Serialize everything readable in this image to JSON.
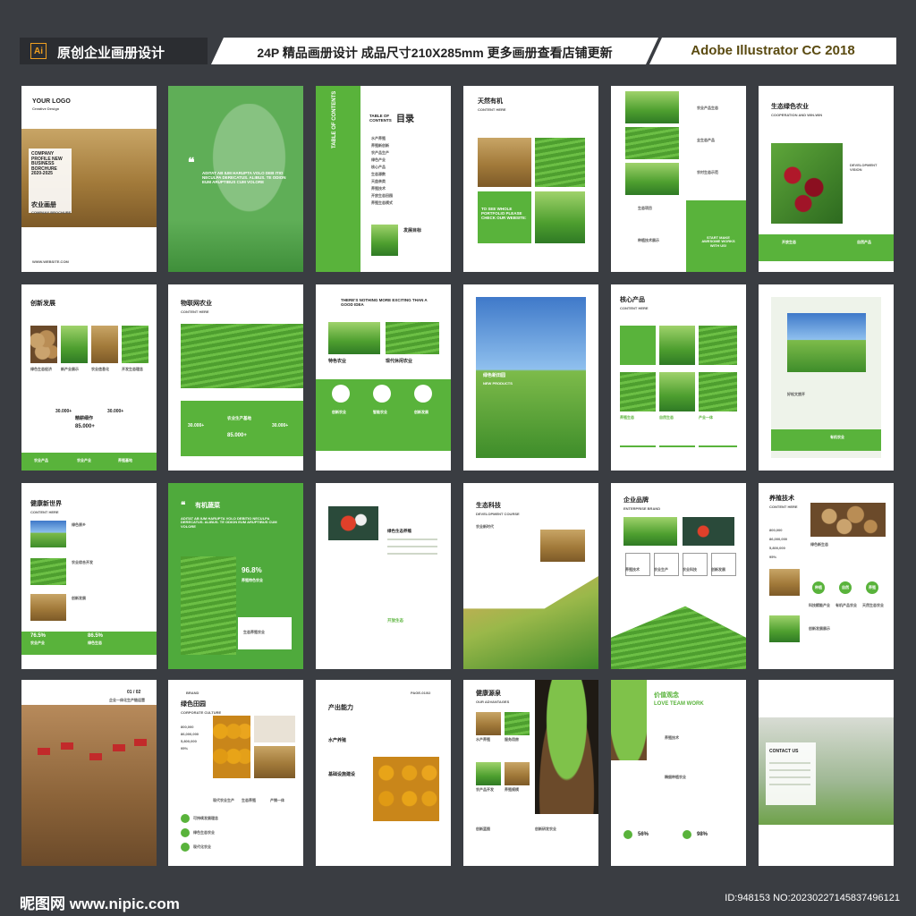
{
  "header": {
    "badge": "Ai",
    "left_title": "原创企业画册设计",
    "middle_title": "24P 精品画册设计 成品尺寸210X285mm 更多画册查看店铺更新",
    "right_title": "Adobe Illustrator CC 2018"
  },
  "pages": {
    "p1": {
      "logo": "YOUR LOGO",
      "logo_sub": "Creative Design",
      "title": "COMPANY PROFILE NEW BUSINESS BORCHURE 2020-2025",
      "cn": "农业画册",
      "cn_sub": "COMPANY BROCHURE",
      "footer": "WWW.WEBSITE.COM"
    },
    "p2": {
      "quote": "ADITAT AB IUM HARUPTA VOLO DEB ITIO NECULPA DERECATUS. ALIBUS. TE ODION EUM ARUPTIBUS CUM VOLORE"
    },
    "p3": {
      "title": "TABLE OF CONTENTS",
      "cn": "目录",
      "items": [
        "水产养殖",
        "养殖新创新",
        "农产品生产",
        "绿色产业",
        "核心产品",
        "生态源数",
        "天益亲类",
        "养殖技术",
        "开放生态田园",
        "养殖生态模式"
      ],
      "goal": "发展目标"
    },
    "p4": {
      "title": "天然有机",
      "sub": "CONTENT HERE",
      "cta": "TO SEE WHOLE PORTFOLIO PLEASE CHECK OUR WEBSITE:"
    },
    "p5": {
      "items": [
        "农业产品生态",
        "全生态产品",
        "农村生态示范",
        "生态项目",
        "种植技术展示"
      ],
      "cta": "START MAKE AWESOME WORKS WITH US!"
    },
    "p6": {
      "title": "生态绿色农业",
      "sub": "COOPERATION AND WIN-WIN",
      "side": "DEVELOPMENT VISION",
      "labels": [
        "开放生态",
        "自然产品"
      ]
    },
    "p7": {
      "title": "创新发展",
      "labels": [
        "绿色生态经济",
        "新产业展示",
        "农业信息化",
        "开发生态理念"
      ],
      "stats": [
        "30.000+",
        "85.000+",
        "30.000+"
      ],
      "stat_label": "SERVICES",
      "mid": "精耕细作",
      "bottom": [
        "农业产品",
        "农业产业",
        "养殖基地"
      ]
    },
    "p8": {
      "title": "物联网农业",
      "sub": "CONTENT HERE",
      "stats": [
        "30.000+",
        "85.000+",
        "30.000+"
      ],
      "mid": "农业生产基地",
      "stat_label": "SERVICES"
    },
    "p9": {
      "title": "THERE'S NOTHING MORE EXCITING THAN A GOOD IDEA",
      "labels": [
        "特色农业",
        "现代休闲农业"
      ],
      "icons": [
        "创新农业",
        "智能农业",
        "创新发展"
      ]
    },
    "p10": {
      "title": "绿色新田园",
      "sub": "NEW PRODUCTS"
    },
    "p11": {
      "title": "核心产品",
      "sub": "CONTENT HERE",
      "labels": [
        "养殖生态",
        "自然生态",
        "产业一体"
      ]
    },
    "p12": {
      "labels": [
        "好松文旅开",
        "有机农业"
      ]
    },
    "p13": {
      "title": "健康新世界",
      "sub": "CONTENT HERE",
      "labels": [
        "绿色原乡",
        "农业综合开发",
        "创新发展"
      ],
      "stats": [
        "76.5%",
        "86.5%"
      ],
      "stat_labels": [
        "农业产业",
        "绿色生态"
      ]
    },
    "p14": {
      "title": "有机蔬菜",
      "quote": "ADITAT AB IUM HARUPTA VOLO DEBITIO NECULPA DERECATUS. ALIBUS. TE ODION EUM ARUPTIBUS CUM VOLORE",
      "stat": "96.8%",
      "stat_label": "养殖特色农业",
      "bottom": "生态养殖农业"
    },
    "p15": {
      "labels": [
        "绿色生态养殖",
        "开放生态"
      ]
    },
    "p16": {
      "title": "生态科技",
      "sub": "DEVELOPMENT COURSE",
      "label": "农业新时代"
    },
    "p17": {
      "title": "企业品牌",
      "sub": "ENTERPRISE BRAND",
      "icons": [
        "养殖技术",
        "农业生产",
        "农业科技",
        "创新发展"
      ]
    },
    "p18": {
      "title": "养殖技术",
      "sub": "CONTENT HERE",
      "stats": [
        "800,000",
        "86,000,000",
        "5,800,000",
        "95%"
      ],
      "label": "绿色新生态",
      "icons": [
        "种植",
        "自然",
        "养殖"
      ],
      "bottom": [
        "科技赋能产业",
        "有机产品农业",
        "天然生态农业"
      ],
      "footer": "创新发展展示"
    },
    "p19": {
      "page": "01 / 02",
      "sub": "企业一体化生产链运营"
    },
    "p20": {
      "brand": "BRAND",
      "title": "绿色田园",
      "sub": "CORPORATE CULTURE",
      "stats": [
        "800,000",
        "86,000,000",
        "5,800,000",
        "95%"
      ],
      "labels": [
        "现代农业生产",
        "生态养殖",
        "产销一体"
      ],
      "items": [
        "可持续发展理念",
        "绿色生态农业",
        "现代化农业"
      ]
    },
    "p21": {
      "title": "产出能力",
      "page": "PAGE-01/02",
      "labels": [
        "水产养殖",
        "基础设施建设"
      ]
    },
    "p22": {
      "title": "健康源泉",
      "sub": "OUR ADVANTAGES",
      "labels": [
        "水产养殖",
        "服务用房",
        "农产品开发",
        "养殖规模"
      ],
      "bottom": [
        "创新蓝图",
        "创新研发农业"
      ]
    },
    "p23": {
      "title": "价值观念",
      "sub": "LOVE TEAM WORK",
      "labels": [
        "养殖技术",
        "精细种植农业"
      ],
      "stats": [
        "56%",
        "98%"
      ]
    },
    "p24": {
      "title": "CONTACT US"
    }
  },
  "watermark": {
    "left": "昵图网 www.nipic.com",
    "right": "ID:948153 NO:20230227145837496121"
  }
}
